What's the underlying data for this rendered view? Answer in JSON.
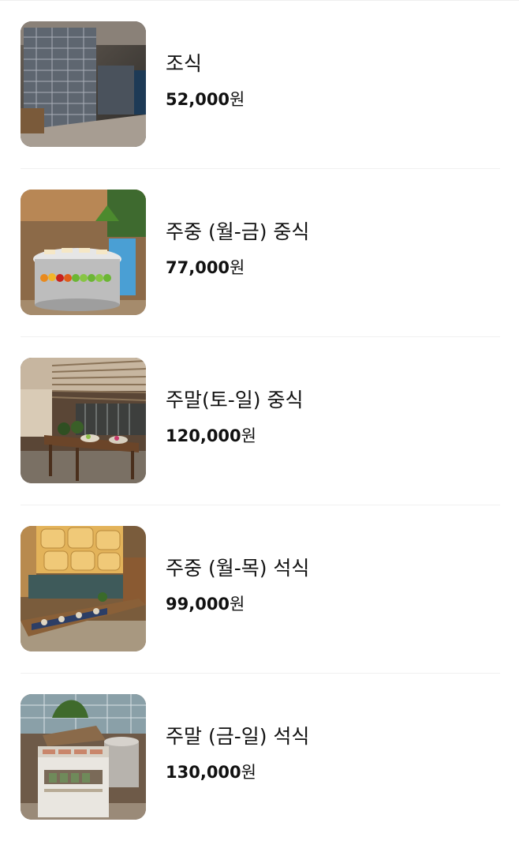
{
  "menu": {
    "items": [
      {
        "name": "조식",
        "price": "52,000",
        "currency": "원",
        "image": "breakfast-wine-cellar-photo"
      },
      {
        "name": "주중 (월-금) 중식",
        "price": "77,000",
        "currency": "원",
        "image": "weekday-lunch-buffet-photo"
      },
      {
        "name": "주말(토-일) 중식",
        "price": "120,000",
        "currency": "원",
        "image": "weekend-lunch-buffet-photo"
      },
      {
        "name": "주중 (월-목) 석식",
        "price": "99,000",
        "currency": "원",
        "image": "weekday-dinner-buffet-photo"
      },
      {
        "name": "주말 (금-일) 석식",
        "price": "130,000",
        "currency": "원",
        "image": "weekend-dinner-buffet-photo"
      }
    ]
  }
}
